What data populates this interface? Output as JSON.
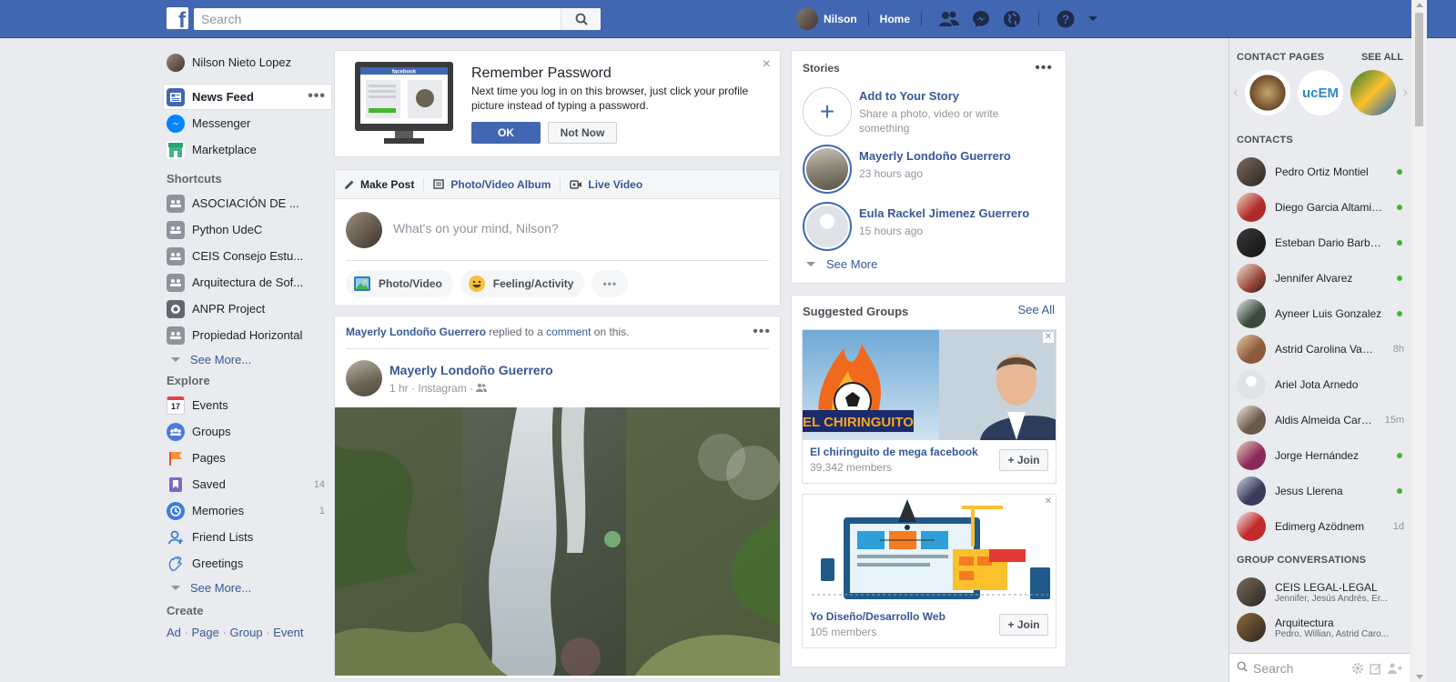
{
  "topbar": {
    "logo_letter": "f",
    "search_placeholder": "Search",
    "user_name": "Nilson",
    "home_label": "Home"
  },
  "leftnav": {
    "profile_name": "Nilson Nieto Lopez",
    "main_items": [
      {
        "label": "News Feed",
        "icon": "news-feed-icon"
      },
      {
        "label": "Messenger",
        "icon": "messenger-icon"
      },
      {
        "label": "Marketplace",
        "icon": "marketplace-icon"
      }
    ],
    "shortcuts_heading": "Shortcuts",
    "shortcuts": [
      {
        "label": "ASOCIACIÓN DE ..."
      },
      {
        "label": "Python UdeC"
      },
      {
        "label": "CEIS Consejo Estu..."
      },
      {
        "label": "Arquitectura de Sof..."
      },
      {
        "label": "ANPR Project"
      },
      {
        "label": "Propiedad Horizontal"
      }
    ],
    "see_more": "See More...",
    "explore_heading": "Explore",
    "explore": [
      {
        "label": "Events",
        "icon": "calendar-icon",
        "count": "",
        "calendar_day": "17"
      },
      {
        "label": "Groups",
        "icon": "groups-icon",
        "count": ""
      },
      {
        "label": "Pages",
        "icon": "flag-icon",
        "count": ""
      },
      {
        "label": "Saved",
        "icon": "bookmark-icon",
        "count": "14"
      },
      {
        "label": "Memories",
        "icon": "clock-icon",
        "count": "1"
      },
      {
        "label": "Friend Lists",
        "icon": "friends-icon",
        "count": ""
      },
      {
        "label": "Greetings",
        "icon": "wave-icon",
        "count": ""
      }
    ],
    "create_heading": "Create",
    "create_links": [
      "Ad",
      "Page",
      "Group",
      "Event"
    ],
    "create_sep": "·"
  },
  "password_card": {
    "title": "Remember Password",
    "text": "Next time you log in on this browser, just click your profile picture instead of typing a password.",
    "ok_label": "OK",
    "not_now_label": "Not Now",
    "screen_logo": "facebook"
  },
  "composer": {
    "tabs": [
      {
        "label": "Make Post",
        "icon": "pencil-icon"
      },
      {
        "label": "Photo/Video Album",
        "icon": "album-icon"
      },
      {
        "label": "Live Video",
        "icon": "video-camera-icon"
      }
    ],
    "placeholder": "What's on your mind, Nilson?",
    "actions": [
      {
        "label": "Photo/Video",
        "icon": "photo-icon"
      },
      {
        "label": "Feeling/Activity",
        "icon": "smiley-icon"
      }
    ],
    "more_label": "•••"
  },
  "post": {
    "activity_actor": "Mayerly Londoño Guerrero",
    "activity_text_1": " replied to a ",
    "activity_link": "comment",
    "activity_text_2": " on this.",
    "author": "Mayerly Londoño Guerrero",
    "time": "1 hr",
    "source": "Instagram",
    "meta_sep": "·",
    "dots": "•••"
  },
  "stories": {
    "title": "Stories",
    "dots": "•••",
    "add_title": "Add to Your Story",
    "add_sub": "Share a photo, video or write something",
    "add_symbol": "+",
    "items": [
      {
        "name": "Mayerly Londoño Guerrero",
        "time": "23 hours ago"
      },
      {
        "name": "Eula Rackel Jimenez Guerrero",
        "time": "15 hours ago"
      }
    ],
    "see_more": "See More"
  },
  "suggested_groups": {
    "title": "Suggested Groups",
    "see_all": "See All",
    "groups": [
      {
        "name": "El chiringuito de mega facebook",
        "members": "39,342 members",
        "banner_text": "EL CHIRINGUITO",
        "join": "Join"
      },
      {
        "name": "Yo Diseño/Desarrollo Web",
        "members": "105 members",
        "join": "Join"
      }
    ],
    "join_plus": "+",
    "close_symbol": "✕"
  },
  "rightbar": {
    "contact_pages_heading": "CONTACT PAGES",
    "see_all": "SEE ALL",
    "contact_pages": [
      {
        "name": "contact-page-1",
        "text": ""
      },
      {
        "name": "contact-page-2",
        "text": "ucEM"
      },
      {
        "name": "contact-page-3",
        "text": ""
      }
    ],
    "contacts_heading": "CONTACTS",
    "contacts": [
      {
        "name": "Pedro Ortiz Montiel",
        "status": "online"
      },
      {
        "name": "Diego Garcia Altamiranda",
        "status": "online"
      },
      {
        "name": "Esteban Dario Barboza",
        "status": "online"
      },
      {
        "name": "Jennifer Alvarez",
        "status": "online"
      },
      {
        "name": "Ayneer Luis Gonzalez",
        "status": "online"
      },
      {
        "name": "Astrid Carolina Vanegas",
        "status": "8h"
      },
      {
        "name": "Ariel Jota Arnedo",
        "status": ""
      },
      {
        "name": "Aldis Almeida Carrascal",
        "status": "15m"
      },
      {
        "name": "Jorge Hernández",
        "status": "online"
      },
      {
        "name": "Jesus Llerena",
        "status": "online"
      },
      {
        "name": "Edimerg Azödnem",
        "status": "1d"
      }
    ],
    "group_conv_heading": "GROUP CONVERSATIONS",
    "group_convs": [
      {
        "name": "CEIS LEGAL-LEGAL",
        "members": "Jennifer, Jesús Andrés, Er..."
      },
      {
        "name": "Arquitectura",
        "members": "Pedro, Willian, Astrid Caro..."
      }
    ],
    "search_placeholder": "Search"
  },
  "colors": {
    "brand": "#4267b2",
    "link": "#365899",
    "online": "#42b72a",
    "background": "#e9ebee"
  }
}
